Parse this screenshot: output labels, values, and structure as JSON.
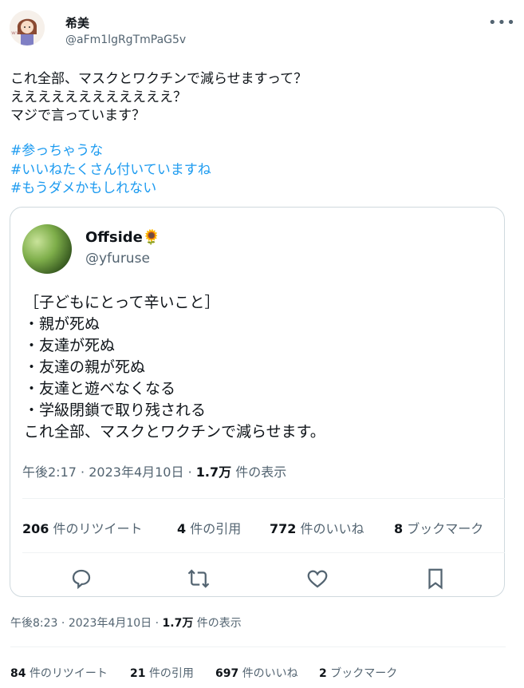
{
  "tweet": {
    "author_name": "希美",
    "author_handle": "@aFm1lgRgTmPaG5v",
    "more_icon": "more-icon",
    "lines": [
      "これ全部、マスクとワクチンで減らせますって？",
      "ええええええええええええ？",
      "マジで言っています？"
    ],
    "hashtags": [
      "#参っちゃうな",
      "#いいねたくさん付いていますね",
      "#もうダメかもしれない"
    ],
    "time": "午後8:23",
    "sep": "·",
    "date": "2023年4月10日",
    "views_count": "1.7万",
    "views_label": "件の表示",
    "stats": [
      {
        "count": "84",
        "label": "件のリツイート"
      },
      {
        "count": "21",
        "label": "件の引用"
      },
      {
        "count": "697",
        "label": "件のいいね"
      },
      {
        "count": "2",
        "label": "ブックマーク"
      }
    ]
  },
  "quoted": {
    "author_name": "Offside🌻",
    "author_handle": "@yfuruse",
    "lines": [
      "［子どもにとって辛いこと］",
      "・親が死ぬ",
      "・友達が死ぬ",
      "・友達の親が死ぬ",
      "・友達と遊べなくなる",
      "・学級閉鎖で取り残される",
      "これ全部、マスクとワクチンで減らせます。"
    ],
    "time": "午後2:17",
    "sep": "·",
    "date": "2023年4月10日",
    "views_count": "1.7万",
    "views_label": "件の表示",
    "stats": [
      {
        "count": "206",
        "label": "件のリツイート"
      },
      {
        "count": "4",
        "label": "件の引用"
      },
      {
        "count": "772",
        "label": "件のいいね"
      },
      {
        "count": "8",
        "label": "ブックマーク"
      }
    ],
    "actions": [
      "reply-icon",
      "retweet-icon",
      "like-icon",
      "bookmark-icon"
    ]
  },
  "colors": {
    "accent": "#1d9bf0",
    "muted": "#536471",
    "text": "#0f1419",
    "border": "#cfd9de"
  }
}
